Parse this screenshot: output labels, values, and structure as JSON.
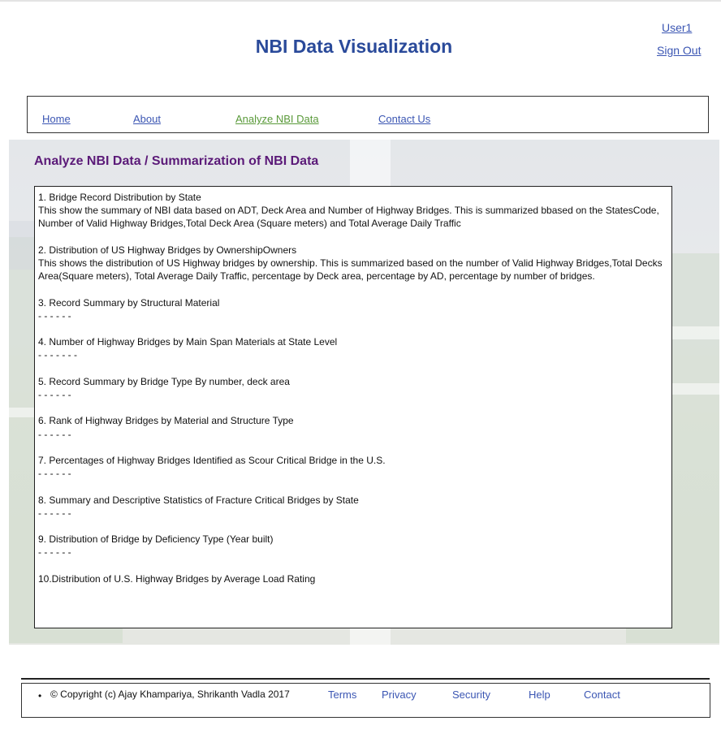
{
  "header": {
    "site_title": "NBI Data Visualization",
    "user_label": "User1",
    "signout_label": "Sign Out"
  },
  "nav": {
    "home": "Home",
    "about": "About",
    "analyze": "Analyze NBI Data",
    "contact": "Contact Us",
    "active": "Analyze NBI Data"
  },
  "main": {
    "section_title": "Analyze NBI Data / Summarization of NBI Data",
    "items": [
      {
        "title": "1. Bridge Record Distribution by State",
        "desc": "This show the summary of NBI data based on ADT, Deck Area and Number of Highway Bridges. This is summarized bbased on the StatesCode, Number of Valid Highway Bridges,Total Deck Area (Square meters) and Total Average Daily Traffic",
        "dashes": ""
      },
      {
        "title": "2. Distribution of US Highway Bridges by OwnershipOwners",
        "desc": "This shows the distribution of US Highway bridges by ownership. This is summarized based on the number of Valid Highway Bridges,Total Decks Area(Square meters), Total Average Daily Traffic, percentage by Deck area, percentage by AD, percentage by number of bridges.",
        "dashes": ""
      },
      {
        "title": "3. Record Summary by Structural Material",
        "desc": "",
        "dashes": "- - - - - -"
      },
      {
        "title": "4. Number of Highway Bridges by Main Span Materials at State Level",
        "desc": "",
        "dashes": "- - - - - - -"
      },
      {
        "title": "5. Record Summary by Bridge Type By number, deck area",
        "desc": "",
        "dashes": " - - - - - -"
      },
      {
        "title": "6. Rank of Highway Bridges by Material and Structure Type",
        "desc": "",
        "dashes": " - - - - - -"
      },
      {
        "title": "7. Percentages of Highway Bridges Identified as Scour Critical Bridge in the U.S.",
        "desc": "",
        "dashes": " - - - - - -"
      },
      {
        "title": "8. Summary and Descriptive Statistics of Fracture Critical Bridges by State",
        "desc": "",
        "dashes": " - - - - - -"
      },
      {
        "title": "9. Distribution of Bridge by Deficiency Type (Year built)",
        "desc": "",
        "dashes": " - - - - - -"
      },
      {
        "title": "10.Distribution of U.S. Highway Bridges by Average Load Rating",
        "desc": "",
        "dashes": ""
      }
    ]
  },
  "footer": {
    "bullet": "•",
    "copyright": "©   Copyright (c) Ajay Khampariya, Shrikanth Vadla 2017",
    "links": [
      "Terms",
      "Privacy",
      "Security",
      "Help",
      "Contact"
    ]
  },
  "colors": {
    "title_blue": "#2a4a9a",
    "link_blue": "#3b56b3",
    "active_green": "#5a9a3a",
    "section_purple": "#5b1a78"
  }
}
